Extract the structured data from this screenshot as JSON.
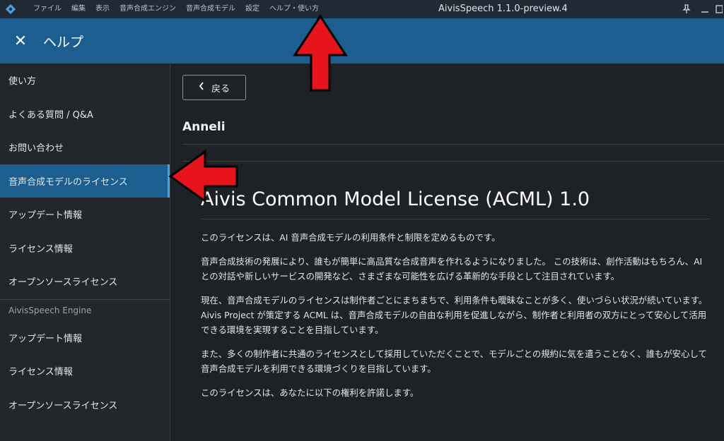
{
  "window": {
    "title": "AivisSpeech 1.1.0-preview.4",
    "logo_icon": "aivis-logo-icon"
  },
  "menu": {
    "items": [
      "ファイル",
      "編集",
      "表示",
      "音声合成エンジン",
      "音声合成モデル",
      "設定",
      "ヘルプ・使い方"
    ]
  },
  "header": {
    "close_symbol": "✕",
    "title": "ヘルプ"
  },
  "sidebar": {
    "items": [
      {
        "label": "使い方",
        "active": false
      },
      {
        "label": "よくある質問 / Q&A",
        "active": false
      },
      {
        "label": "お問い合わせ",
        "active": false
      },
      {
        "label": "音声合成モデルのライセンス",
        "active": true
      },
      {
        "label": "アップデート情報",
        "active": false
      },
      {
        "label": "ライセンス情報",
        "active": false
      },
      {
        "label": "オープンソースライセンス",
        "active": false
      }
    ],
    "engine_section": {
      "label": "AivisSpeech Engine",
      "items": [
        "アップデート情報",
        "ライセンス情報",
        "オープンソースライセンス"
      ]
    }
  },
  "main": {
    "back_label": "戻る",
    "model_name": "Anneli",
    "license_title": "Aivis Common Model License (ACML) 1.0",
    "paragraphs": [
      "このライセンスは、AI 音声合成モデルの利用条件と制限を定めるものです。",
      "音声合成技術の発展により、誰もが簡単に高品質な合成音声を作れるようになりました。 この技術は、創作活動はもちろん、AI との対話や新しいサービスの開発など、さまざまな可能性を広げる革新的な手段として注目されています。",
      "現在、音声合成モデルのライセンスは制作者ごとにまちまちで、利用条件も曖昧なことが多く、使いづらい状況が続いています。 Aivis Project が策定する ACML は、音声合成モデルの自由な利用を促進しながら、制作者と利用者の双方にとって安心して活用できる環境を実現することを目指しています。",
      "また、多くの制作者に共通のライセンスとして採用していただくことで、モデルごとの規約に気を遣うことなく、誰もが安心して音声合成モデルを利用できる環境づくりを目指しています。",
      "このライセンスは、あなたに以下の権利を許諾します。"
    ]
  },
  "colors": {
    "accent": "#1c5e8f",
    "annotation_arrow": "#e8141c"
  }
}
